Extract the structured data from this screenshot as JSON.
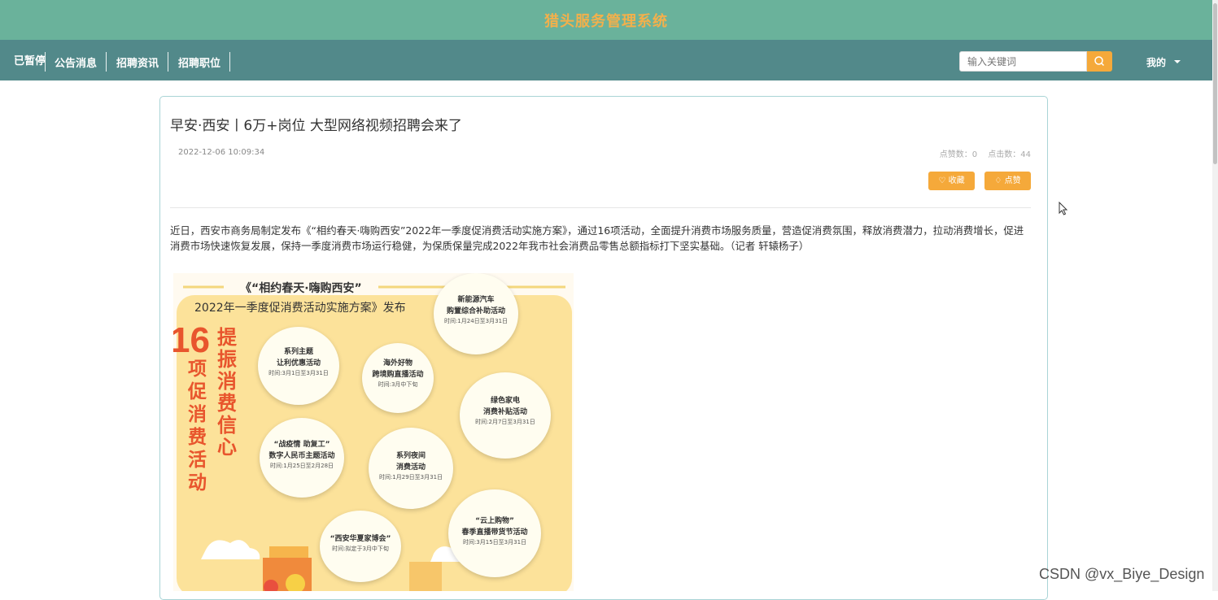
{
  "app_title": "猎头服务管理系统",
  "nav": {
    "left_label": "已暂停",
    "items": [
      {
        "label": "公告消息"
      },
      {
        "label": "招聘资讯"
      },
      {
        "label": "招聘职位"
      }
    ],
    "search_placeholder": "输入关键词",
    "user_menu": "我的"
  },
  "article": {
    "title": "早安·西安丨6万+岗位 大型网络视频招聘会来了",
    "datetime": "2022-12-06 10:09:34",
    "likes_label": "点赞数：0",
    "clicks_label": "点击数：44",
    "favorite_button": "♡ 收藏",
    "like_button": "♢ 点赞",
    "body": "近日，西安市商务局制定发布《“相约春天·嗨购西安”2022年一季度促消费活动实施方案》，通过16项活动，全面提升消费市场服务质量，营造促消费氛围，释放消费潜力，拉动消费增长，促进消费市场快速恢复发展，保持一季度消费市场运行稳健，为保质保量完成2022年我市社会消费品零售总额指标打下坚实基础。（记者 轩辕杨子）"
  },
  "poster": {
    "heading_1": "《“相约春天·嗨购西安”",
    "heading_2": "2022年一季度促消费活动实施方案》发布",
    "big_number": "16",
    "vertical_left": "项促消费活动",
    "vertical_right": "提振消费信心",
    "bubbles": [
      {
        "l1": "新能源汽车",
        "l2": "购置综合补助活动",
        "t": "时间:1月24日至3月31日"
      },
      {
        "l1": "系列主题",
        "l2": "让利优惠活动",
        "t": "时间:3月1日至3月31日"
      },
      {
        "l1": "海外好物",
        "l2": "跨境购直播活动",
        "t": "时间:3月中下旬"
      },
      {
        "l1": "绿色家电",
        "l2": "消费补贴活动",
        "t": "时间:2月7日至3月31日"
      },
      {
        "l1": "“战疫情 助复工”",
        "l2": "数字人民币主题活动",
        "t": "时间:1月25日至2月28日"
      },
      {
        "l1": "系列夜间",
        "l2": "消费活动",
        "t": "时间:1月29日至3月31日"
      },
      {
        "l1": "“云上购物”",
        "l2": "春季直播带货节活动",
        "t": "时间:3月15日至3月31日"
      },
      {
        "l1": "“西安华夏家博会”",
        "l2": "",
        "t": "时间:拟定于3月中下旬"
      }
    ]
  },
  "watermark": "CSDN @vx_Biye_Design",
  "colors": {
    "header_bg": "#6ab29b",
    "nav_bg": "#52898a",
    "accent": "#f5a93a",
    "title_text": "#f3b04b"
  }
}
